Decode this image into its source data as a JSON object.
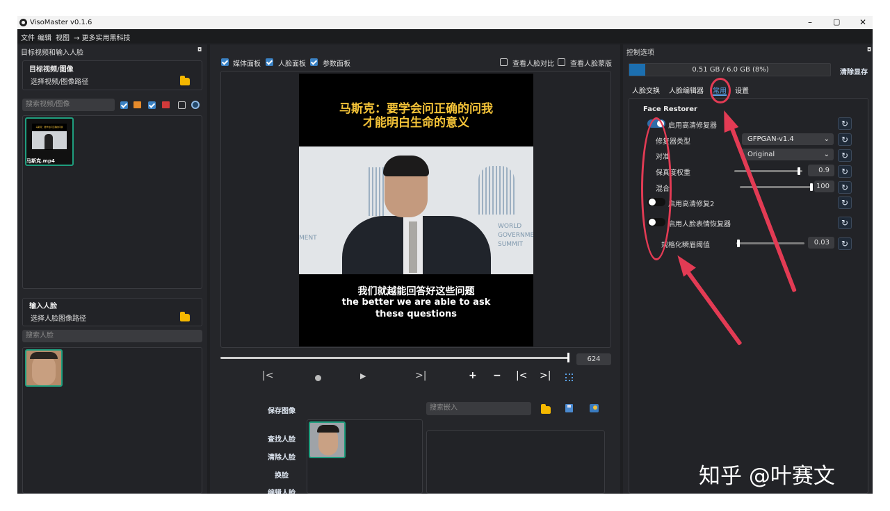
{
  "app": {
    "title": "VisoMaster v0.1.6",
    "min_glyph": "–",
    "restore_glyph": "▢",
    "close_glyph": "✕"
  },
  "menu": {
    "items": [
      "文件",
      "编辑",
      "视图",
      "→ 更多实用黑科技"
    ]
  },
  "left": {
    "panel_title": "目标视频和输入人脸",
    "target_section_title": "目标视频/图像",
    "target_path_label": "选择视频/图像路径",
    "target_search_placeholder": "搜索视频/图像",
    "thumb_filename": "马斯克.mp4",
    "thumb_caption": "马斯克：要学会问正确的问我",
    "input_section_title": "输入人脸",
    "input_path_label": "选择人脸图像路径",
    "face_search_placeholder": "搜索人脸"
  },
  "center": {
    "checks": [
      {
        "label": "媒体面板",
        "checked": true
      },
      {
        "label": "人脸面板",
        "checked": true
      },
      {
        "label": "参数面板",
        "checked": true
      }
    ],
    "right_checks": [
      {
        "label": "查看人脸对比",
        "checked": false
      },
      {
        "label": "查看人脸蒙版",
        "checked": false
      }
    ],
    "video_caption_top_1": "马斯克：要学会问正确的问我",
    "video_caption_top_2": "才能明白生命的意义",
    "video_caption_bottom_zh": "我们就越能回答好这些问题",
    "video_caption_bottom_en_1": "the better we are able to ask",
    "video_caption_bottom_en_2": "these questions",
    "bg_text_left": "MENT",
    "bg_text_world": "WORLD",
    "bg_text_gov": "GOVERNMEN",
    "bg_text_summit": "SUMMIT",
    "frame_number": "624",
    "frame_progress": 1.0,
    "save_image_label": "保存图像",
    "embed_search_placeholder": "搜索嵌入",
    "face_actions": [
      "查找人脸",
      "清除人脸",
      "换脸",
      "编辑人脸"
    ]
  },
  "right": {
    "panel_title": "控制选项",
    "memory_text": "0.51 GB / 6.0 GB (8%)",
    "memory_fraction": 0.08,
    "clear_memory_label": "清除显存",
    "tabs": [
      "人脸交换",
      "人脸编辑器",
      "常用",
      "设置"
    ],
    "active_tab": "常用",
    "section_title": "Face Restorer",
    "enable_restorer_label": "启用高清修复器",
    "enable_restorer_on": true,
    "restorer_type_label": "修复器类型",
    "restorer_type_value": "GFPGAN-v1.4",
    "align_label": "对准",
    "align_value": "Original",
    "fidelity_label": "保真度权重",
    "fidelity_value": "0.9",
    "blend_label": "混合",
    "blend_value": "100",
    "enable_restorer2_label": "启用高清修复2",
    "enable_restorer2_on": false,
    "enable_expression_label": "启用人脸表情恢复器",
    "enable_expression_on": false,
    "blink_label": "规格化瞬眉阈值",
    "blink_value": "0.03"
  },
  "watermark": "知乎 @叶赛文",
  "colors": {
    "accent": "#3b82c4",
    "annotation": "#e33b54",
    "folder": "#f5b800"
  }
}
